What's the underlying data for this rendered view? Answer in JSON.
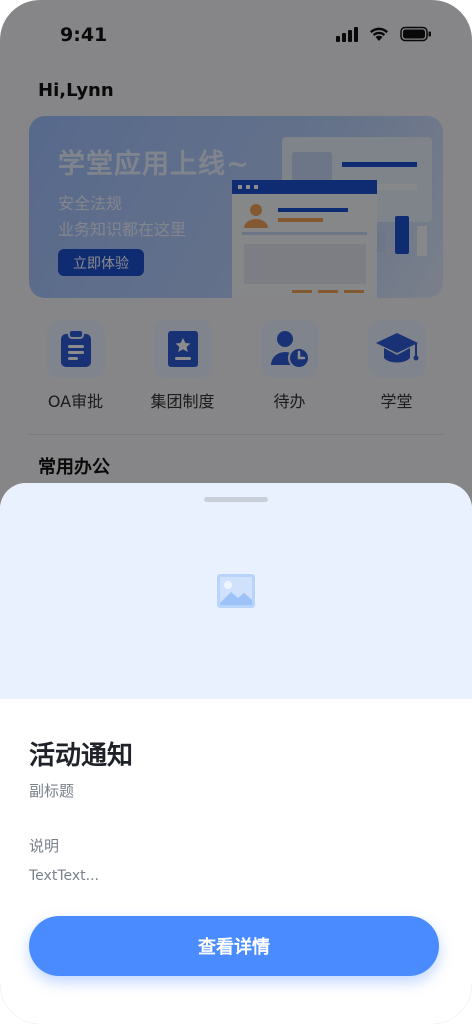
{
  "status_bar": {
    "time": "9:41"
  },
  "greeting": "Hi,Lynn",
  "banner": {
    "title": "学堂应用上线~",
    "line1": "安全法规",
    "line2": "业务知识都在这里",
    "button_label": "立即体验"
  },
  "apps": [
    {
      "label": "OA审批",
      "icon": "clipboard-icon"
    },
    {
      "label": "集团制度",
      "icon": "rulebook-icon"
    },
    {
      "label": "待办",
      "icon": "user-clock-icon"
    },
    {
      "label": "学堂",
      "icon": "graduation-cap-icon"
    }
  ],
  "section_title": "常用办公",
  "sheet": {
    "image_icon": "image-placeholder-icon",
    "title": "活动通知",
    "subtitle": "副标题",
    "description_label": "说明",
    "description_text": "TextText...",
    "button_label": "查看详情"
  },
  "colors": {
    "primary": "#4a8cff",
    "banner_button": "#1d4fd0",
    "sheet_media_bg": "#e9f1ff",
    "app_icon_blue": "#2f5bd6"
  }
}
